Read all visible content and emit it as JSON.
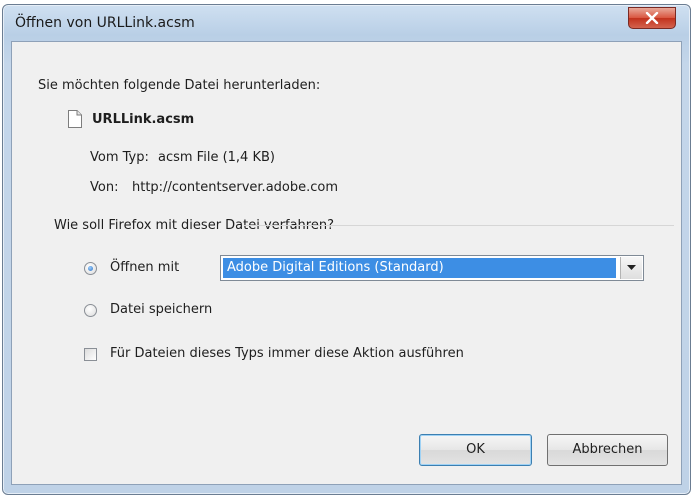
{
  "window": {
    "title": "Öffnen von URLLink.acsm"
  },
  "intro": "Sie möchten folgende Datei herunterladen:",
  "file": {
    "name": "URLLink.acsm",
    "type_label": "Vom Typ:",
    "type_value": "acsm File (1,4 KB)",
    "from_label": "Von:",
    "from_value": "http://contentserver.adobe.com"
  },
  "question": "Wie soll Firefox mit dieser Datei verfahren?",
  "options": {
    "open_with_label": "Öffnen mit",
    "open_with_selected": true,
    "open_with_app": "Adobe Digital Editions (Standard)",
    "save_file_label": "Datei speichern",
    "save_file_selected": false,
    "always_label": "Für Dateien dieses Typs immer diese Aktion ausführen",
    "always_checked": false
  },
  "buttons": {
    "ok": "OK",
    "cancel": "Abbrechen"
  },
  "icons": {
    "close": "close-icon",
    "file": "file-icon",
    "dropdown": "chevron-down-icon"
  },
  "colors": {
    "selection": "#3d8ee4",
    "close_button": "#c2321d"
  }
}
